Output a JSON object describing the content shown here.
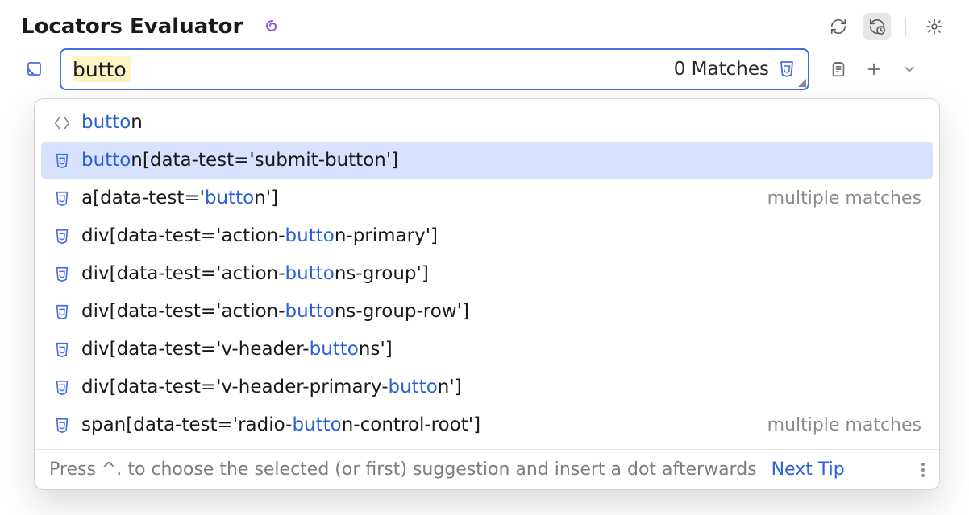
{
  "header": {
    "title": "Locators Evaluator"
  },
  "search": {
    "value": "butto",
    "matches_label": "0 Matches"
  },
  "suggestions": [
    {
      "icon": "tag",
      "segments": [
        {
          "t": "butto",
          "hl": true
        },
        {
          "t": "n",
          "hl": false
        }
      ],
      "tail": "",
      "selected": false
    },
    {
      "icon": "css",
      "segments": [
        {
          "t": "butto",
          "hl": true
        },
        {
          "t": "n[data-test='submit-button']",
          "hl": false
        }
      ],
      "tail": "",
      "selected": true
    },
    {
      "icon": "css",
      "segments": [
        {
          "t": "a[data-test='",
          "hl": false
        },
        {
          "t": "butto",
          "hl": true
        },
        {
          "t": "n']",
          "hl": false
        }
      ],
      "tail": "multiple matches",
      "selected": false
    },
    {
      "icon": "css",
      "segments": [
        {
          "t": "div[data-test='action-",
          "hl": false
        },
        {
          "t": "butto",
          "hl": true
        },
        {
          "t": "n-primary']",
          "hl": false
        }
      ],
      "tail": "",
      "selected": false
    },
    {
      "icon": "css",
      "segments": [
        {
          "t": "div[data-test='action-",
          "hl": false
        },
        {
          "t": "butto",
          "hl": true
        },
        {
          "t": "ns-group']",
          "hl": false
        }
      ],
      "tail": "",
      "selected": false
    },
    {
      "icon": "css",
      "segments": [
        {
          "t": "div[data-test='action-",
          "hl": false
        },
        {
          "t": "butto",
          "hl": true
        },
        {
          "t": "ns-group-row']",
          "hl": false
        }
      ],
      "tail": "",
      "selected": false
    },
    {
      "icon": "css",
      "segments": [
        {
          "t": "div[data-test='v-header-",
          "hl": false
        },
        {
          "t": "butto",
          "hl": true
        },
        {
          "t": "ns']",
          "hl": false
        }
      ],
      "tail": "",
      "selected": false
    },
    {
      "icon": "css",
      "segments": [
        {
          "t": "div[data-test='v-header-primary-",
          "hl": false
        },
        {
          "t": "butto",
          "hl": true
        },
        {
          "t": "n']",
          "hl": false
        }
      ],
      "tail": "",
      "selected": false
    },
    {
      "icon": "css",
      "segments": [
        {
          "t": "span[data-test='radio-",
          "hl": false
        },
        {
          "t": "butto",
          "hl": true
        },
        {
          "t": "n-control-root']",
          "hl": false
        }
      ],
      "tail": "multiple matches",
      "selected": false
    }
  ],
  "footer": {
    "hint": "Press ^. to choose the selected (or first) suggestion and insert a dot afterwards",
    "link": "Next Tip"
  }
}
